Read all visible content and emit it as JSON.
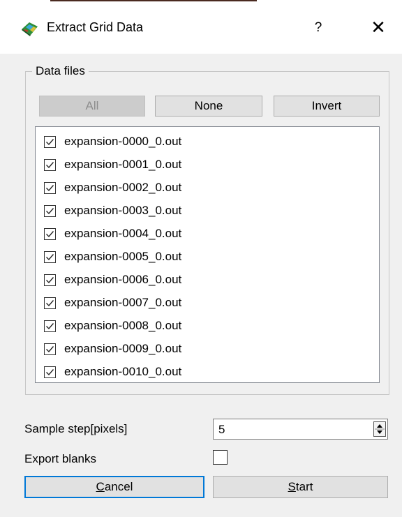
{
  "dialog": {
    "title": "Extract Grid Data",
    "help_label": "?",
    "close_label": "✕"
  },
  "data_files": {
    "group_label": "Data files",
    "buttons": {
      "all": "All",
      "none": "None",
      "invert": "Invert"
    },
    "all_disabled": true,
    "files": [
      {
        "name": "expansion-0000_0.out",
        "checked": true
      },
      {
        "name": "expansion-0001_0.out",
        "checked": true
      },
      {
        "name": "expansion-0002_0.out",
        "checked": true
      },
      {
        "name": "expansion-0003_0.out",
        "checked": true
      },
      {
        "name": "expansion-0004_0.out",
        "checked": true
      },
      {
        "name": "expansion-0005_0.out",
        "checked": true
      },
      {
        "name": "expansion-0006_0.out",
        "checked": true
      },
      {
        "name": "expansion-0007_0.out",
        "checked": true
      },
      {
        "name": "expansion-0008_0.out",
        "checked": true
      },
      {
        "name": "expansion-0009_0.out",
        "checked": true
      },
      {
        "name": "expansion-0010_0.out",
        "checked": true
      }
    ]
  },
  "options": {
    "sample_step_label": "Sample step[pixels]",
    "sample_step_value": "5",
    "export_blanks_label": "Export blanks",
    "export_blanks_checked": false
  },
  "footer": {
    "cancel_mnemonic": "C",
    "cancel_rest": "ancel",
    "start_mnemonic": "S",
    "start_rest": "tart"
  },
  "colors": {
    "focus_border": "#0078d7",
    "window_bg": "#f0f0f0",
    "title_bg": "#ffffff"
  },
  "icons": {
    "app": "grid-surface-icon",
    "help": "help-icon",
    "close": "close-icon",
    "checkbox": "checkmark-icon",
    "spinner": "spin-up-down-icon"
  }
}
